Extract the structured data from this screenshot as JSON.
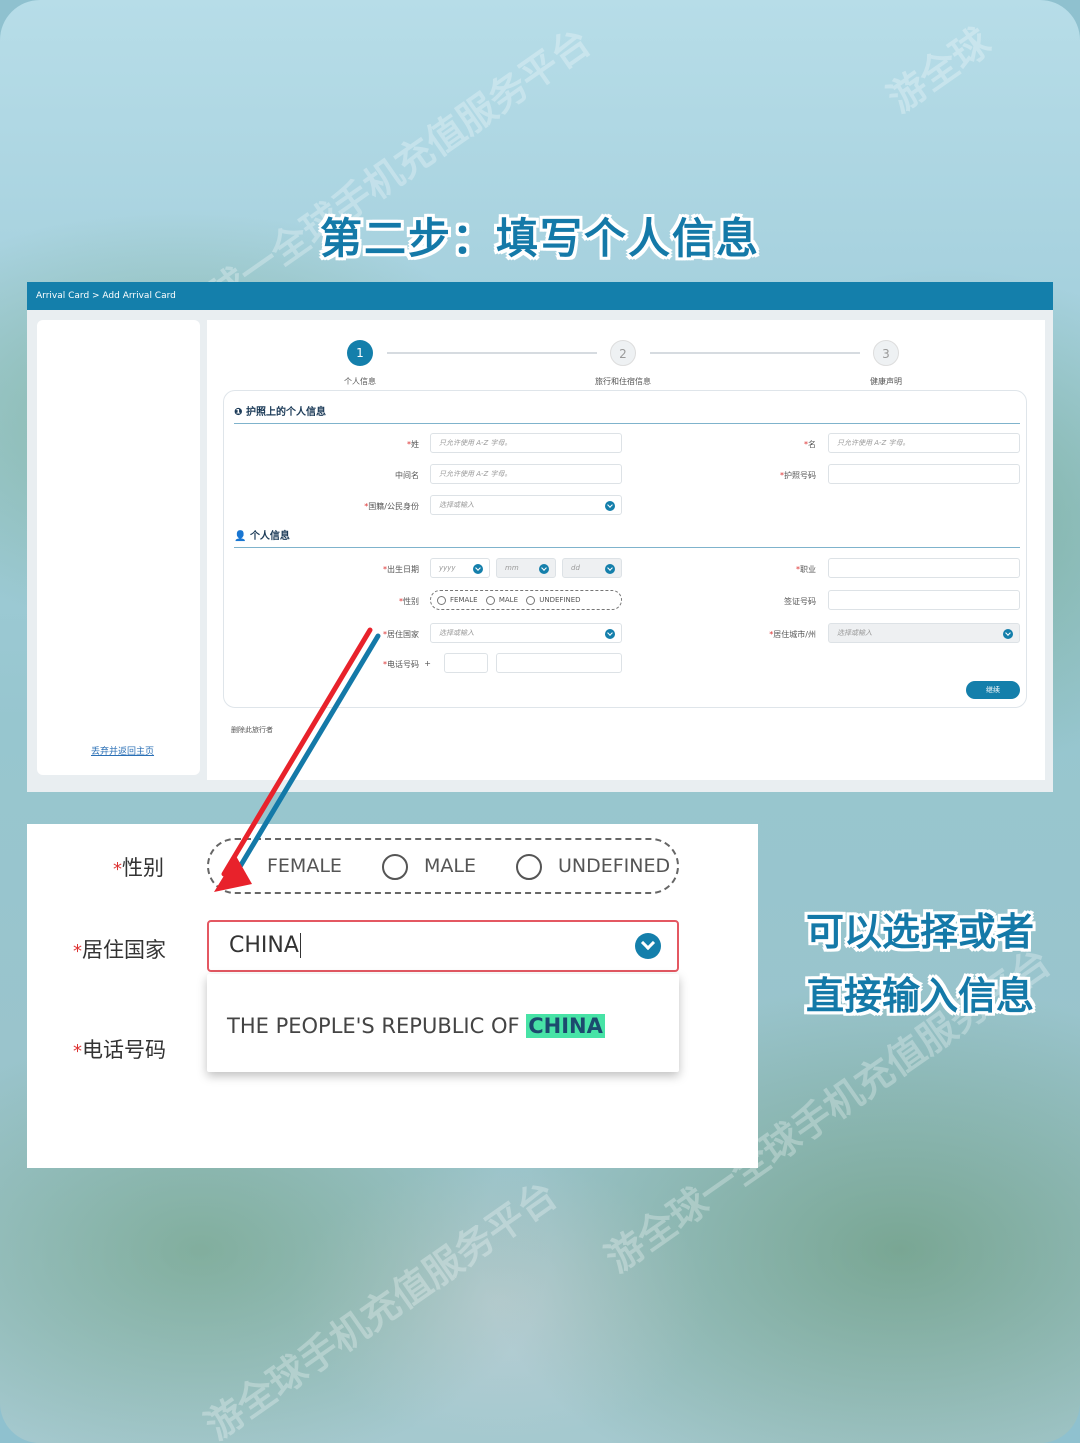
{
  "title": "第二步：填写个人信息",
  "breadcrumb": "Arrival Card > Add Arrival Card",
  "steps": [
    {
      "num": "1",
      "label": "个人信息"
    },
    {
      "num": "2",
      "label": "旅行和住宿信息"
    },
    {
      "num": "3",
      "label": "健康声明"
    }
  ],
  "sections": {
    "passport": "护照上的个人信息",
    "personal": "个人信息"
  },
  "fields": {
    "surname": "姓",
    "given_name": "名",
    "middle_name": "中间名",
    "passport_no": "护照号码",
    "nationality": "国籍/公民身份",
    "dob": "出生日期",
    "occupation": "职业",
    "gender": "性别",
    "visa_no": "签证号码",
    "country_residence": "居住国家",
    "city_residence": "居住城市/州",
    "phone": "电话号码"
  },
  "placeholders": {
    "latin_only": "只允许使用 A-Z 字母。",
    "select_or_type": "选择或输入",
    "yyyy": "yyyy",
    "mm": "mm",
    "dd": "dd",
    "plus": "+"
  },
  "gender_options": [
    "FEMALE",
    "MALE",
    "UNDEFINED"
  ],
  "buttons": {
    "next": "继续",
    "remove_traveler": "删除此旅行者",
    "discard_home": "丢弃并返回主页"
  },
  "zoom": {
    "gender_label": "性别",
    "country_label": "居住国家",
    "phone_label": "电话号码",
    "country_value": "CHINA",
    "option_prefix": "THE PEOPLE'S REPUBLIC OF ",
    "option_match": "CHINA"
  },
  "side_note": [
    "可以选择或者",
    "直接输入信息"
  ],
  "watermarks": [
    "游全球一全球手机充值服务平台",
    "游全球",
    "游全球一全球手机充值服务平台",
    "游全球手机充值服务平台"
  ],
  "colors": {
    "primary": "#147fab",
    "highlight": "#47e3a6",
    "error": "#e45862",
    "arrow": "#e8222b"
  }
}
